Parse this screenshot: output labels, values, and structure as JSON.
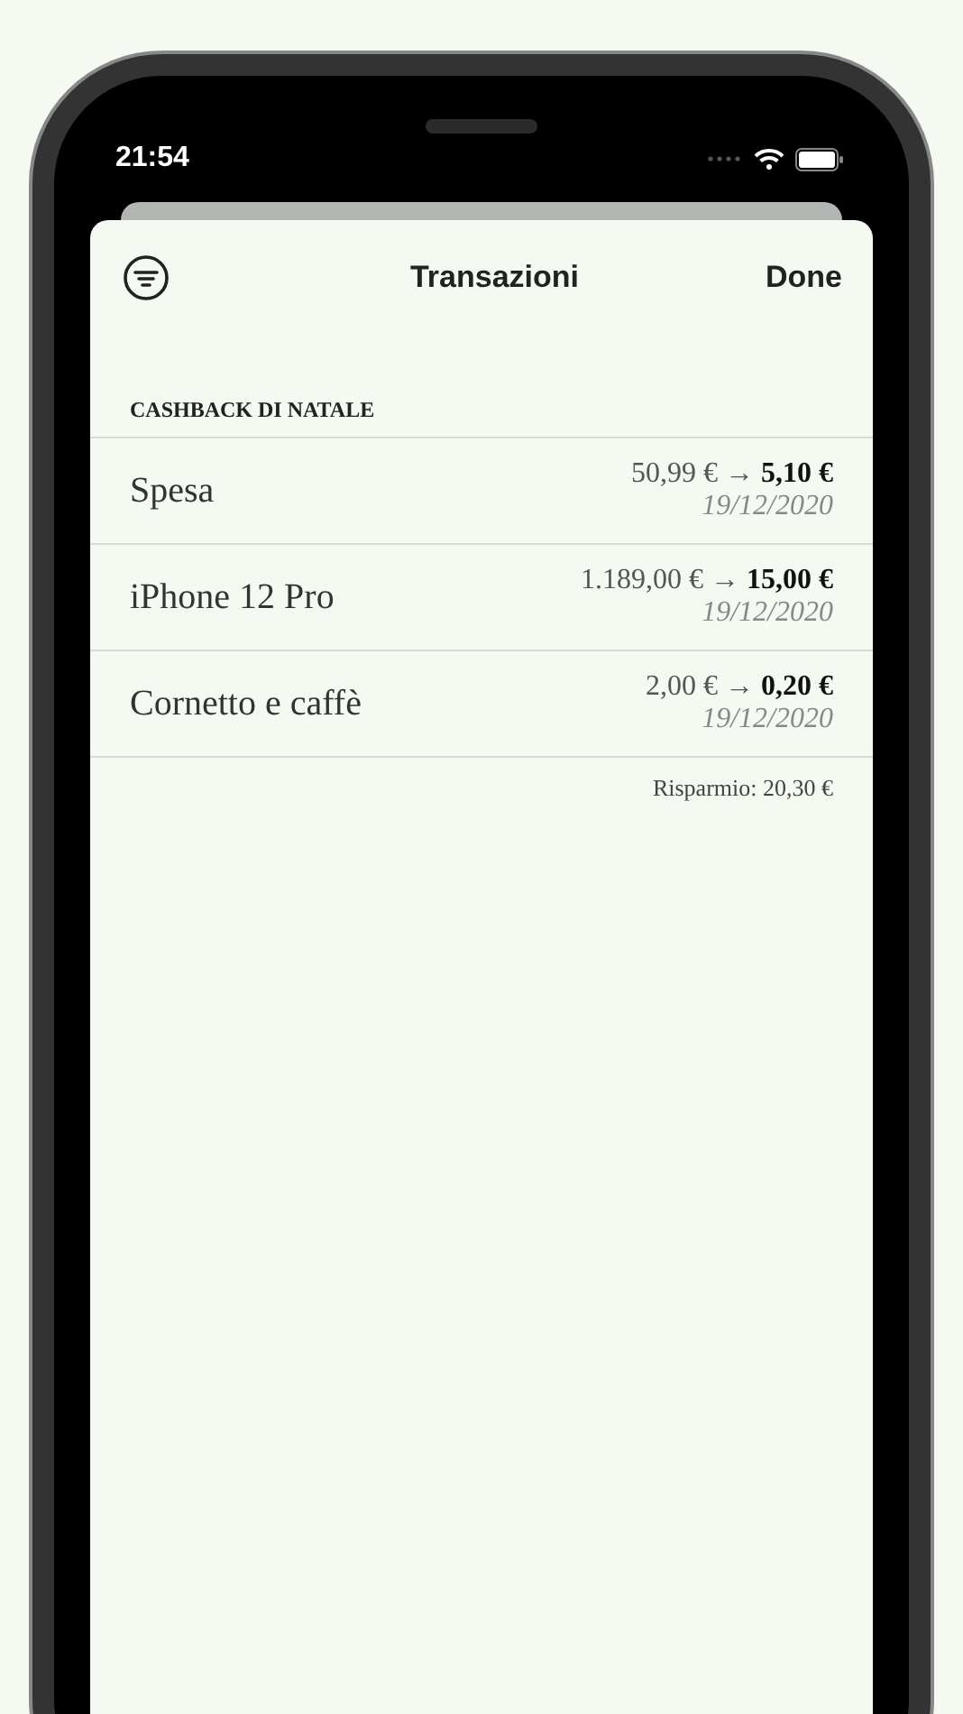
{
  "status_bar": {
    "time": "21:54"
  },
  "sheet": {
    "title": "Transazioni",
    "done_button": "Done"
  },
  "section": {
    "header": "CASHBACK DI NATALE",
    "transactions": [
      {
        "name": "Spesa",
        "amount": "50,99 € → **5,10 €**",
        "date": "19/12/2020"
      },
      {
        "name": "iPhone 12 Pro",
        "amount": "1.189,00 € → **15,00 €**",
        "date": "19/12/2020"
      },
      {
        "name": "Cornetto e caffè",
        "amount": "2,00 € → **0,20 €**",
        "date": "19/12/2020"
      }
    ],
    "footer": "Risparmio: 20,30 €"
  }
}
